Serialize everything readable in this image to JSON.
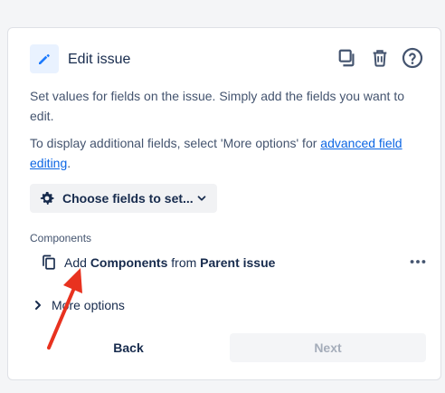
{
  "header": {
    "title": "Edit issue",
    "icons": [
      "pencil-icon",
      "copy-icon",
      "trash-icon",
      "help-icon"
    ]
  },
  "description": {
    "line1": "Set values for fields on the issue. Simply add the fields you want to edit.",
    "line2_prefix": "To display additional fields, select 'More options' for ",
    "line2_link": "advanced field editing",
    "line2_suffix": "."
  },
  "choose_fields_label": "Choose fields to set...",
  "components": {
    "section_label": "Components",
    "add": "Add",
    "field": "Components",
    "from": "from",
    "source": "Parent issue"
  },
  "more_options_label": "More options",
  "footer": {
    "back_label": "Back",
    "next_label": "Next"
  },
  "colors": {
    "accent": "#0c66e4",
    "annotation_arrow": "#e8321f"
  }
}
